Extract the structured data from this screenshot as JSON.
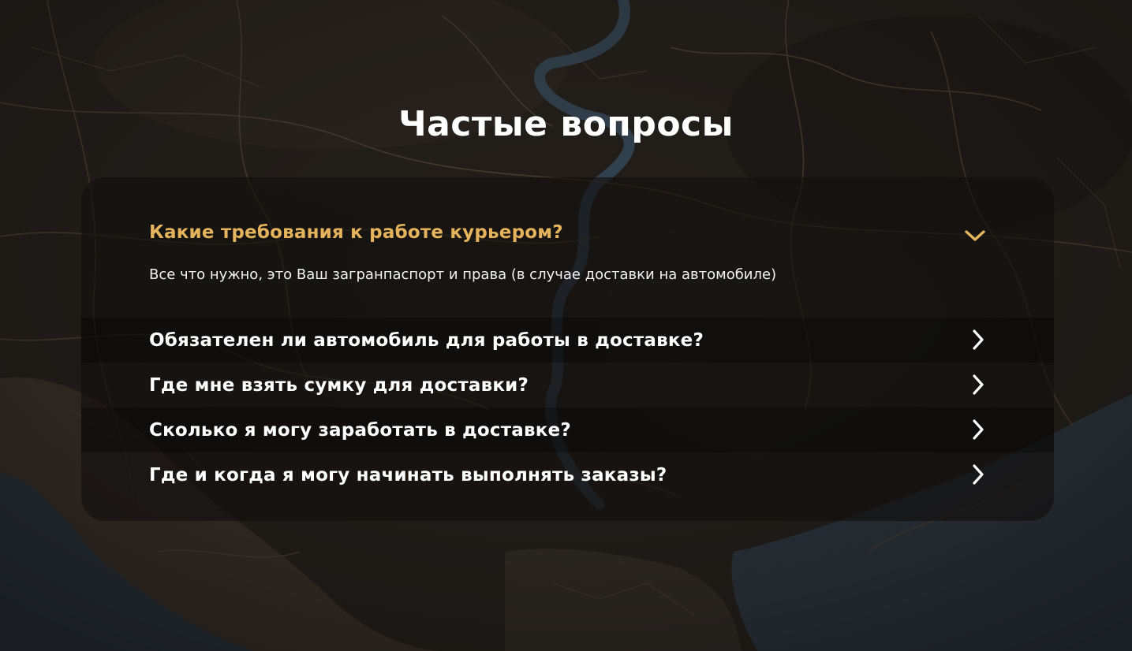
{
  "title": "Частые вопросы",
  "colors": {
    "accent": "#e6b35d",
    "text": "#ffffff",
    "card_bg": "rgba(18,15,13,0.62)"
  },
  "faq": {
    "open_item": {
      "question": "Какие требования к работе курьером?",
      "answer": "Все что нужно, это Ваш загранпаспорт и права (в случае доставки на автомобиле)",
      "icon": "chevron-down-icon"
    },
    "items": [
      {
        "question": "Обязателен ли автомобиль для работы в доставке?",
        "icon": "chevron-right-icon"
      },
      {
        "question": "Где мне взять сумку для доставки?",
        "icon": "chevron-right-icon"
      },
      {
        "question": "Сколько я могу заработать в доставке?",
        "icon": "chevron-right-icon"
      },
      {
        "question": "Где и когда я могу начинать выполнять заказы?",
        "icon": "chevron-right-icon"
      }
    ]
  }
}
